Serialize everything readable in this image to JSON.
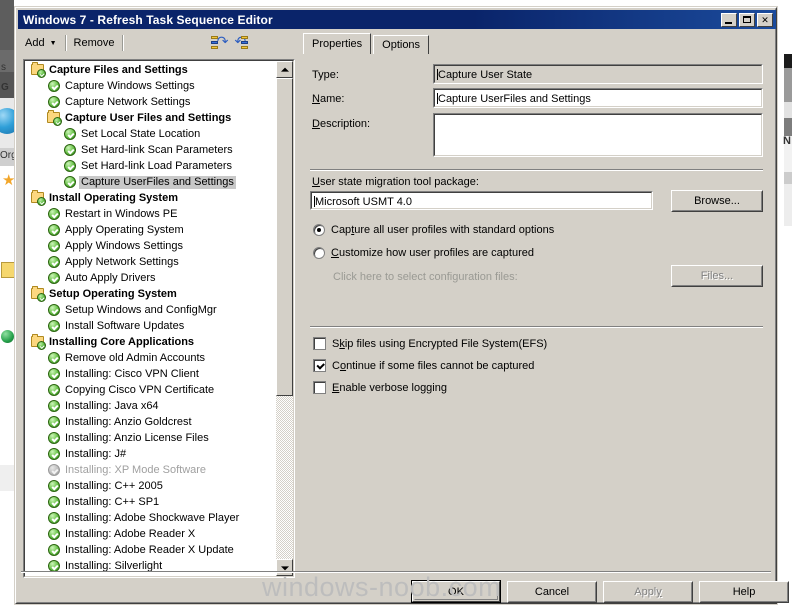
{
  "window": {
    "title": "Windows 7 - Refresh Task Sequence Editor",
    "minimize_label": "Minimize",
    "maximize_label": "Maximize",
    "close_label": "✕"
  },
  "toolbar": {
    "add_label": "Add",
    "add_arrow": "▼",
    "remove_label": "Remove",
    "move_up_icon": "move-up-icon",
    "move_down_icon": "move-down-icon"
  },
  "tabs": [
    {
      "label": "Properties",
      "active": true
    },
    {
      "label": "Options",
      "active": false
    }
  ],
  "tree": {
    "nodes": [
      {
        "label": "Capture Files and Settings",
        "type": "folder",
        "indent": 0,
        "selected": false,
        "disabled": false
      },
      {
        "label": "Capture Windows Settings",
        "type": "check",
        "indent": 1,
        "selected": false,
        "disabled": false
      },
      {
        "label": "Capture Network Settings",
        "type": "check",
        "indent": 1,
        "selected": false,
        "disabled": false
      },
      {
        "label": "Capture User Files and Settings",
        "type": "folder",
        "indent": 1,
        "selected": false,
        "disabled": false
      },
      {
        "label": "Set Local State Location",
        "type": "check",
        "indent": 2,
        "selected": false,
        "disabled": false
      },
      {
        "label": "Set Hard-link Scan Parameters",
        "type": "check",
        "indent": 2,
        "selected": false,
        "disabled": false
      },
      {
        "label": "Set Hard-link Load Parameters",
        "type": "check",
        "indent": 2,
        "selected": false,
        "disabled": false
      },
      {
        "label": "Capture UserFiles and Settings",
        "type": "check",
        "indent": 2,
        "selected": true,
        "disabled": false
      },
      {
        "label": "Install Operating System",
        "type": "folder",
        "indent": 0,
        "selected": false,
        "disabled": false
      },
      {
        "label": "Restart in Windows PE",
        "type": "check",
        "indent": 1,
        "selected": false,
        "disabled": false
      },
      {
        "label": "Apply Operating System",
        "type": "check",
        "indent": 1,
        "selected": false,
        "disabled": false
      },
      {
        "label": "Apply Windows Settings",
        "type": "check",
        "indent": 1,
        "selected": false,
        "disabled": false
      },
      {
        "label": "Apply Network Settings",
        "type": "check",
        "indent": 1,
        "selected": false,
        "disabled": false
      },
      {
        "label": "Auto Apply Drivers",
        "type": "check",
        "indent": 1,
        "selected": false,
        "disabled": false
      },
      {
        "label": "Setup Operating System",
        "type": "folder",
        "indent": 0,
        "selected": false,
        "disabled": false
      },
      {
        "label": "Setup Windows and ConfigMgr",
        "type": "check",
        "indent": 1,
        "selected": false,
        "disabled": false
      },
      {
        "label": "Install Software Updates",
        "type": "check",
        "indent": 1,
        "selected": false,
        "disabled": false
      },
      {
        "label": "Installing Core Applications",
        "type": "folder",
        "indent": 0,
        "selected": false,
        "disabled": false
      },
      {
        "label": "Remove old Admin Accounts",
        "type": "check",
        "indent": 1,
        "selected": false,
        "disabled": false
      },
      {
        "label": "Installing: Cisco VPN Client",
        "type": "check",
        "indent": 1,
        "selected": false,
        "disabled": false
      },
      {
        "label": "Copying Cisco VPN Certificate",
        "type": "check",
        "indent": 1,
        "selected": false,
        "disabled": false
      },
      {
        "label": "Installing: Java x64",
        "type": "check",
        "indent": 1,
        "selected": false,
        "disabled": false
      },
      {
        "label": "Installing: Anzio Goldcrest",
        "type": "check",
        "indent": 1,
        "selected": false,
        "disabled": false
      },
      {
        "label": "Installing: Anzio License Files",
        "type": "check",
        "indent": 1,
        "selected": false,
        "disabled": false
      },
      {
        "label": "Installing: J#",
        "type": "check",
        "indent": 1,
        "selected": false,
        "disabled": false
      },
      {
        "label": "Installing: XP Mode Software",
        "type": "grey",
        "indent": 1,
        "selected": false,
        "disabled": true
      },
      {
        "label": "Installing: C++ 2005",
        "type": "check",
        "indent": 1,
        "selected": false,
        "disabled": false
      },
      {
        "label": "Installing: C++ SP1",
        "type": "check",
        "indent": 1,
        "selected": false,
        "disabled": false
      },
      {
        "label": "Installing: Adobe Shockwave Player",
        "type": "check",
        "indent": 1,
        "selected": false,
        "disabled": false
      },
      {
        "label": "Installing: Adobe Reader X",
        "type": "check",
        "indent": 1,
        "selected": false,
        "disabled": false
      },
      {
        "label": "Installing: Adobe Reader X Update",
        "type": "check",
        "indent": 1,
        "selected": false,
        "disabled": false
      },
      {
        "label": "Installing: Silverlight",
        "type": "check",
        "indent": 1,
        "selected": false,
        "disabled": false
      }
    ],
    "scroll_up_label": "▲",
    "scroll_down_label": "▼"
  },
  "properties": {
    "type_label": "Type:",
    "type_value": "Capture User State",
    "name_label_pre": "",
    "name_label_accel": "N",
    "name_label_post": "ame:",
    "name_value": "Capture UserFiles and Settings",
    "description_label_accel": "D",
    "description_label_post": "escription:",
    "description_value": "",
    "usmt_label_accel": "U",
    "usmt_label_post": "ser state migration tool package:",
    "usmt_value": "Microsoft USMT 4.0",
    "browse_label": "Browse...",
    "radio_capture_all_pre": "Cap",
    "radio_capture_all_accel": "t",
    "radio_capture_all_post": "ure all user profiles with standard options",
    "radio_capture_all_selected": true,
    "radio_customize_accel": "C",
    "radio_customize_post": "ustomize how user profiles are captured",
    "radio_customize_selected": false,
    "config_files_hint": "Click here to select configuration files:",
    "files_button_label": "Files...",
    "files_button_disabled": true,
    "check_efs_pre": "S",
    "check_efs_accel": "k",
    "check_efs_post": "ip files using Encrypted File System(EFS)",
    "check_efs_checked": false,
    "check_continue_pre": "C",
    "check_continue_accel": "o",
    "check_continue_post": "ntinue if some files cannot be captured",
    "check_continue_checked": true,
    "check_verbose_accel": "E",
    "check_verbose_post": "nable verbose logging",
    "check_verbose_checked": false
  },
  "footer": {
    "ok_label": "OK",
    "cancel_label": "Cancel",
    "apply_pre": "Appl",
    "apply_accel": "y",
    "apply_disabled": true,
    "help_label": "Help"
  },
  "watermark": {
    "text": "windows-noob.com"
  },
  "background": {
    "snippet_1": "s",
    "snippet_2": "G",
    "snippet_3": "Org",
    "snippet_right": "N"
  },
  "colors": {
    "titlebar": "#0a246a",
    "face": "#d4d0c8",
    "selection": "#c8c8c8",
    "disabled_text": "#a0a0a0",
    "watermark": "#bdbdbd"
  }
}
